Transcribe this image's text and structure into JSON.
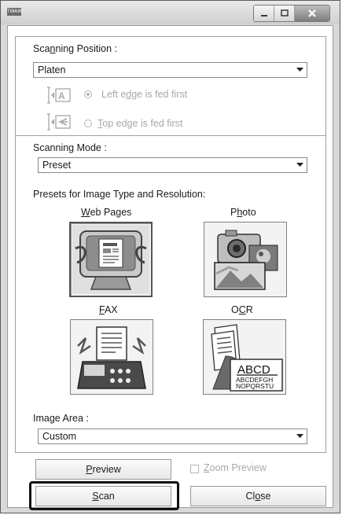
{
  "window": {
    "icon_label": "TWAIN"
  },
  "scanning_position": {
    "label_before": "Sca",
    "label_hot": "n",
    "label_after": "ning Position :",
    "value": "Platen",
    "left_edge": {
      "before": "Left e",
      "hot": "d",
      "after": "ge is fed first"
    },
    "top_edge": {
      "before": "",
      "hot": "T",
      "after": "op edge is fed first"
    }
  },
  "scanning_mode": {
    "label": "Scanning Mode :",
    "value": "Preset"
  },
  "presets": {
    "label": "Presets for Image Type and Resolution:",
    "web_pages": {
      "before": "",
      "hot": "W",
      "after": "eb Pages"
    },
    "photo": {
      "before": "P",
      "hot": "h",
      "after": "oto"
    },
    "fax": {
      "before": "",
      "hot": "F",
      "after": "AX"
    },
    "ocr": {
      "before": "O",
      "hot": "C",
      "after": "R"
    },
    "ocr_art": {
      "line1": "ABCD",
      "line2": "ABCDEFGH",
      "line3": "NOPQRSTU"
    }
  },
  "image_area": {
    "label": "Image Area :",
    "value": "Custom"
  },
  "buttons": {
    "preview": {
      "before": "",
      "hot": "P",
      "after": "review"
    },
    "zoom_preview": {
      "before": "",
      "hot": "Z",
      "after": "oom Preview"
    },
    "scan": {
      "before": "",
      "hot": "S",
      "after": "can"
    },
    "close": {
      "before": "Cl",
      "hot": "o",
      "after": "se"
    }
  },
  "colors": {
    "focus_ring": "#111111",
    "disabled_text": "#a8a8a8"
  }
}
